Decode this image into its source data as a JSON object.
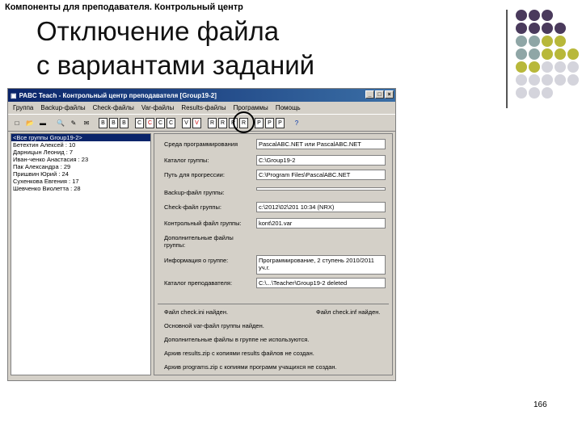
{
  "slide": {
    "header": "Компоненты для преподавателя. Контрольный центр",
    "title_line1": "Отключение файла",
    "title_line2": "с вариантами заданий",
    "page_number": "166",
    "dot_colors": [
      "#4a3a5c",
      "#8fa6a6",
      "#b8b83a",
      "#d4d4dc"
    ]
  },
  "window": {
    "title": "PABC Teach - Контрольный центр преподавателя [Group19-2]",
    "menu": [
      "Группа",
      "Backup-файлы",
      "Check-файлы",
      "Var-файлы",
      "Results-файлы",
      "Программы",
      "Помощь"
    ],
    "toolbar_icons": [
      "new-icon",
      "open-icon",
      "save-icon",
      "preview-icon",
      "edit-icon",
      "mail-icon",
      "doc-b-icon",
      "doc-b-icon",
      "doc-b-icon",
      "doc-c-icon",
      "doc-c-delete-icon",
      "doc-c-icon",
      "doc-c-icon",
      "doc-v-icon",
      "doc-v-delete-icon",
      "doc-r-icon",
      "doc-r-icon",
      "doc-r-icon",
      "doc-r-icon",
      "doc-p-icon",
      "doc-p-icon",
      "doc-p-icon",
      "help-icon"
    ],
    "toolbar_glyphs": [
      "□",
      "📂",
      "▬",
      "🔍",
      "✎",
      "✉",
      "B",
      "B",
      "B",
      "C",
      "C",
      "C",
      "C",
      "V",
      "V",
      "R",
      "R",
      "R",
      "R",
      "P",
      "P",
      "P",
      "?"
    ],
    "students": [
      "<Все группы Group19-2>",
      "Бетехтин Алексей : 10",
      "Дарницын Леонид : 7",
      "Иван-ченко Анастасия : 23",
      "Пак Александра : 29",
      "Пришвин Юрий : 24",
      "Сухенкова Евгения : 17",
      "Шевченко Виолетта : 28"
    ],
    "fields": [
      {
        "label": "Среда программирования",
        "value": "PascalABC.NET или PascalABC.NET"
      },
      {
        "label": "Каталог группы:",
        "value": "C:\\Group19-2"
      },
      {
        "label": "Путь для прогрессии:",
        "value": "C:\\Program Files\\PascalABC.NET"
      },
      {
        "label": "Backup-файл группы:",
        "value": ""
      },
      {
        "label": "Check-файл группы:",
        "value": "c:\\2012\\02\\201 10:34 (NRX)"
      },
      {
        "label": "Контрольный файл группы:",
        "value": "kont\\201.var"
      },
      {
        "label": "Дополнительные файлы группы:",
        "value": ""
      },
      {
        "label": "Информация о группе:",
        "value": "Программирование, 2 ступень 2010/2011 уч.г."
      },
      {
        "label": "Каталог преподавателя:",
        "value": "C:\\...\\Teacher\\Group19-2 deleted"
      }
    ],
    "status": [
      "Файл check.ini найден.",
      "Основной var-файл группы найден.",
      "Дополнительные файлы в группе не используются.",
      "Архив results.zip с копиями results файлов не создан.",
      "Архив programs.zip с копиями программ учащихся не создан."
    ],
    "status_right": "Файл check.inf найден."
  }
}
